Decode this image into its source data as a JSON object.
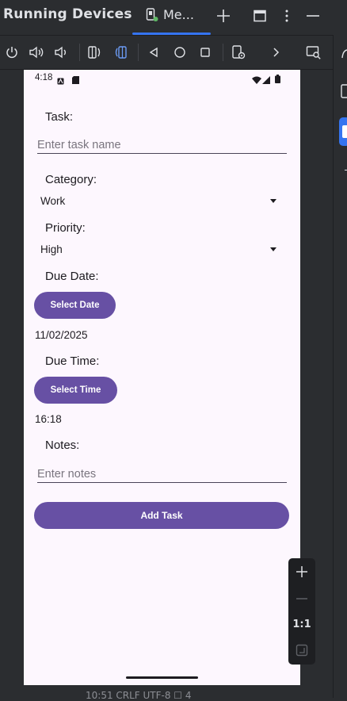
{
  "window": {
    "title": "Running Devices",
    "tab_label": "Me...",
    "bottom_status": "10:51   CRLF   UTF-8   ☐   4"
  },
  "zoom": {
    "ratio_label": "1:1"
  },
  "device": {
    "status_time": "4:18",
    "form": {
      "task_label": "Task:",
      "task_placeholder": "Enter task name",
      "category_label": "Category:",
      "category_value": "Work",
      "priority_label": "Priority:",
      "priority_value": "High",
      "due_date_label": "Due Date:",
      "select_date_button": "Select Date",
      "due_date_value": "11/02/2025",
      "due_time_label": "Due Time:",
      "select_time_button": "Select Time",
      "due_time_value": "16:18",
      "notes_label": "Notes:",
      "notes_placeholder": "Enter notes",
      "add_task_button": "Add Task"
    }
  },
  "colors": {
    "accent": "#6750a4",
    "ide_background": "#2b2d30",
    "device_background": "#fdf7fe",
    "tab_underline": "#3574f0"
  },
  "icons": {
    "toolbar": [
      "power-icon",
      "volume-up-icon",
      "volume-down-icon",
      "rotate-left-icon",
      "rotate-right-icon",
      "back-icon",
      "home-icon",
      "overview-icon",
      "device-settings-icon",
      "more-chevron-icon",
      "device-frame-icon"
    ],
    "titlebar": [
      "device-tab-icon",
      "add-icon",
      "window-icon",
      "more-vert-icon",
      "minimize-icon"
    ],
    "status_bar": [
      "notification-icon",
      "sd-card-icon",
      "wifi-icon",
      "signal-icon",
      "battery-icon"
    ],
    "zoom": [
      "zoom-in-icon",
      "zoom-out-icon",
      "fit-screen-icon"
    ]
  }
}
